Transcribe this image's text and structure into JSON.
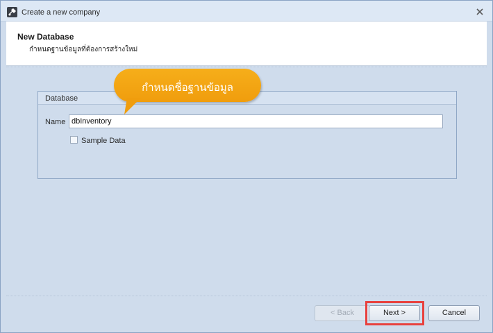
{
  "window": {
    "title": "Create a new company",
    "app_icon": "wizard-tool-icon",
    "close_icon": "close-icon"
  },
  "header": {
    "title": "New Database",
    "subtitle": "กำหนดฐานข้อมูลที่ต้องการสร้างใหม่"
  },
  "callout": {
    "text": "กำหนดชื่อฐานข้อมูล",
    "color": "#f4a516"
  },
  "database_group": {
    "title": "Database",
    "name_label": "Name",
    "name_value": "dbInventory",
    "sample_data_label": "Sample Data",
    "sample_data_checked": false
  },
  "footer": {
    "back_label": "< Back",
    "next_label": "Next >",
    "cancel_label": "Cancel",
    "highlight_color": "#e8413e"
  }
}
